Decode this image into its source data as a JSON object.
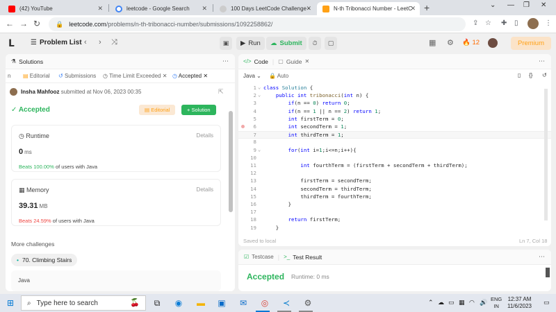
{
  "browser": {
    "tabs": [
      {
        "title": "(42) YouTube",
        "color": "#ff0000"
      },
      {
        "title": "leetcode - Google Search",
        "color": "#4285f4"
      },
      {
        "title": "100 Days LeetCode Challenge -",
        "color": "#888888"
      },
      {
        "title": "N-th Tribonacci Number - LeetC",
        "color": "#ffa116"
      }
    ],
    "url_host": "leetcode.com",
    "url_path": "/problems/n-th-tribonacci-number/submissions/1092258862/"
  },
  "lc_nav": {
    "problem_list": "Problem List",
    "run": "Run",
    "submit": "Submit",
    "streak": "12",
    "premium": "Premium"
  },
  "left_panel": {
    "header": "Solutions",
    "tabs": [
      "Editorial",
      "Submissions",
      "Time Limit Exceeded",
      "Accepted"
    ],
    "author": "Insha Mahfooz",
    "submitted_at": "submitted at Nov 06, 2023 00:35",
    "status": "Accepted",
    "editorial_btn": "Editorial",
    "solution_btn": "Solution",
    "runtime": {
      "label": "Runtime",
      "details": "Details",
      "value": "0",
      "unit": "ms",
      "beats": "Beats 100.00%",
      "suffix": "of users with Java"
    },
    "memory": {
      "label": "Memory",
      "details": "Details",
      "value": "39.31",
      "unit": "MB",
      "beats": "Beats 24.59%",
      "suffix": "of users with Java"
    },
    "more_challenges": "More challenges",
    "challenge": "70. Climbing Stairs",
    "language": "Java"
  },
  "editor": {
    "header_code": "Code",
    "header_guide": "Guide",
    "language": "Java",
    "mode": "Auto",
    "saved": "Saved to local",
    "cursor": "Ln 7, Col 18",
    "lines": [
      "class Solution {",
      "    public int tribonacci(int n) {",
      "        if(n == 0) return 0;",
      "        if(n == 1 || n == 2) return 1;",
      "        int firstTerm = 0;",
      "        int secondTerm = 1;",
      "        int thirdTerm = 1;",
      "",
      "        for(int i=1;i<=n;i++){",
      "",
      "            int fourthTerm = (firstTerm + secondTerm + thirdTerm);",
      "",
      "            firstTerm = secondTerm;",
      "            secondTerm = thirdTerm;",
      "            thirdTerm = fourthTerm;",
      "        }",
      "",
      "        return firstTerm;",
      "    }"
    ]
  },
  "result_panel": {
    "testcase": "Testcase",
    "test_result": "Test Result",
    "status": "Accepted",
    "runtime": "Runtime: 0 ms"
  },
  "taskbar": {
    "search_placeholder": "Type here to search",
    "lang": "ENG",
    "region": "IN",
    "time": "12:37 AM",
    "date": "11/6/2023"
  }
}
